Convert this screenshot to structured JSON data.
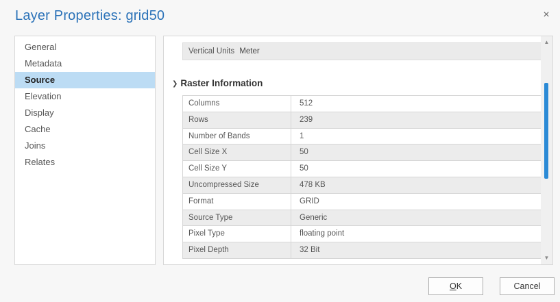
{
  "window": {
    "title": "Layer Properties: grid50",
    "close_glyph": "×"
  },
  "sidebar": {
    "items": [
      {
        "label": "General",
        "selected": false
      },
      {
        "label": "Metadata",
        "selected": false
      },
      {
        "label": "Source",
        "selected": true
      },
      {
        "label": "Elevation",
        "selected": false
      },
      {
        "label": "Display",
        "selected": false
      },
      {
        "label": "Cache",
        "selected": false
      },
      {
        "label": "Joins",
        "selected": false
      },
      {
        "label": "Relates",
        "selected": false
      }
    ]
  },
  "content": {
    "vertical_units": {
      "label": "Vertical Units",
      "value": "Meter"
    },
    "section_title": "Raster Information",
    "rows": [
      {
        "key": "Columns",
        "value": "512"
      },
      {
        "key": "Rows",
        "value": "239"
      },
      {
        "key": "Number of Bands",
        "value": "1"
      },
      {
        "key": "Cell Size X",
        "value": "50"
      },
      {
        "key": "Cell Size Y",
        "value": "50"
      },
      {
        "key": "Uncompressed Size",
        "value": "478 KB"
      },
      {
        "key": "Format",
        "value": "GRID"
      },
      {
        "key": "Source Type",
        "value": "Generic"
      },
      {
        "key": "Pixel Type",
        "value": "floating point"
      },
      {
        "key": "Pixel Depth",
        "value": "32 Bit"
      }
    ]
  },
  "buttons": {
    "ok_underlined": "O",
    "ok_rest": "K",
    "cancel": "Cancel"
  },
  "colors": {
    "title": "#2b72b8",
    "selected_bg": "#bcdcf4",
    "scroll_thumb": "#2b8ad6"
  }
}
